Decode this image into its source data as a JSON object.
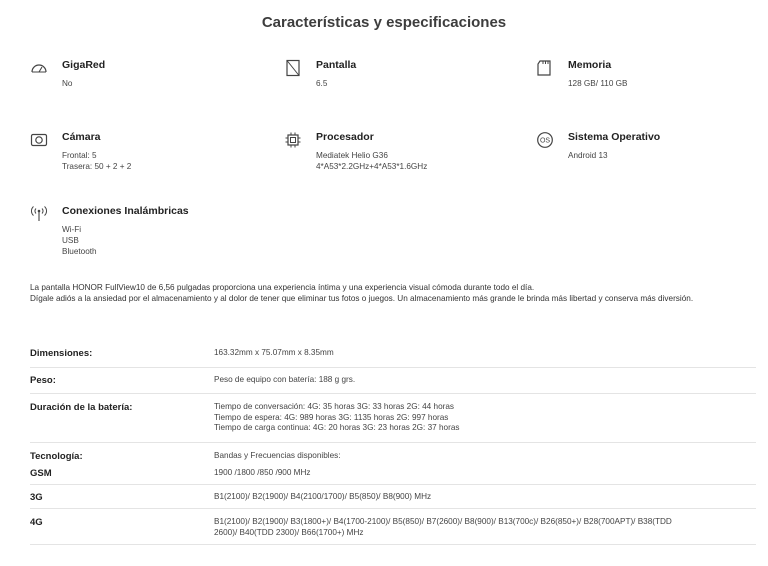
{
  "page": {
    "title": "Características y especificaciones"
  },
  "specs": [
    {
      "icon": "gauge-icon",
      "label": "GigaRed",
      "values": [
        "No"
      ]
    },
    {
      "icon": "screen-icon",
      "label": "Pantalla",
      "values": [
        "6.5"
      ]
    },
    {
      "icon": "memory-card-icon",
      "label": "Memoria",
      "values": [
        "128 GB/ 110 GB"
      ]
    },
    {
      "icon": "camera-icon",
      "label": "Cámara",
      "values": [
        "Frontal: 5",
        "Trasera: 50 + 2 + 2"
      ]
    },
    {
      "icon": "processor-icon",
      "label": "Procesador",
      "values": [
        "Mediatek Helio G36",
        "4*A53*2.2GHz+4*A53*1.6GHz"
      ]
    },
    {
      "icon": "os-icon",
      "icon_text": "OS",
      "label": "Sistema Operativo",
      "values": [
        "Android 13"
      ]
    },
    {
      "icon": "wireless-icon",
      "label": "Conexiones Inalámbricas",
      "values": [
        "Wi-Fi",
        "USB",
        "Bluetooth"
      ]
    }
  ],
  "description": [
    "La pantalla HONOR FullView10 de 6,56 pulgadas proporciona una experiencia íntima y una experiencia visual cómoda durante todo el día.",
    "Dígale adiós a la ansiedad por el almacenamiento y al dolor de tener que eliminar tus fotos o juegos. Un almacenamiento más grande le brinda más libertad y conserva más diversión."
  ],
  "table": [
    {
      "key": "Dimensiones:",
      "values": [
        "163.32mm x 75.07mm x 8.35mm"
      ]
    },
    {
      "key": "Peso:",
      "values": [
        "Peso de equipo con batería: 188 g grs."
      ]
    },
    {
      "key": "Duración de la batería:",
      "values": [
        "Tiempo de conversación: 4G:  35 horas 3G:  33 horas 2G:  44 horas",
        "Tiempo de espera: 4G:  989 horas 3G:  1135 horas 2G:  997 horas",
        "Tiempo de carga continua: 4G:  20 horas 3G:  23 horas 2G:  37 horas"
      ]
    },
    {
      "key": "Tecnología:",
      "values": [
        "Bandas y Frecuencias disponibles:"
      ]
    },
    {
      "key": "GSM",
      "values": [
        "1900 /1800 /850 /900 MHz"
      ]
    },
    {
      "key": "3G",
      "values": [
        "B1(2100)/ B2(1900)/ B4(2100/1700)/ B5(850)/ B8(900) MHz"
      ]
    },
    {
      "key": "4G",
      "values": [
        "B1(2100)/ B2(1900)/ B3(1800+)/ B4(1700-2100)/ B5(850)/ B7(2600)/ B8(900)/ B13(700c)/ B26(850+)/ B28(700APT)/ B38(TDD",
        "2600)/ B40(TDD 2300)/ B66(1700+) MHz"
      ]
    }
  ]
}
